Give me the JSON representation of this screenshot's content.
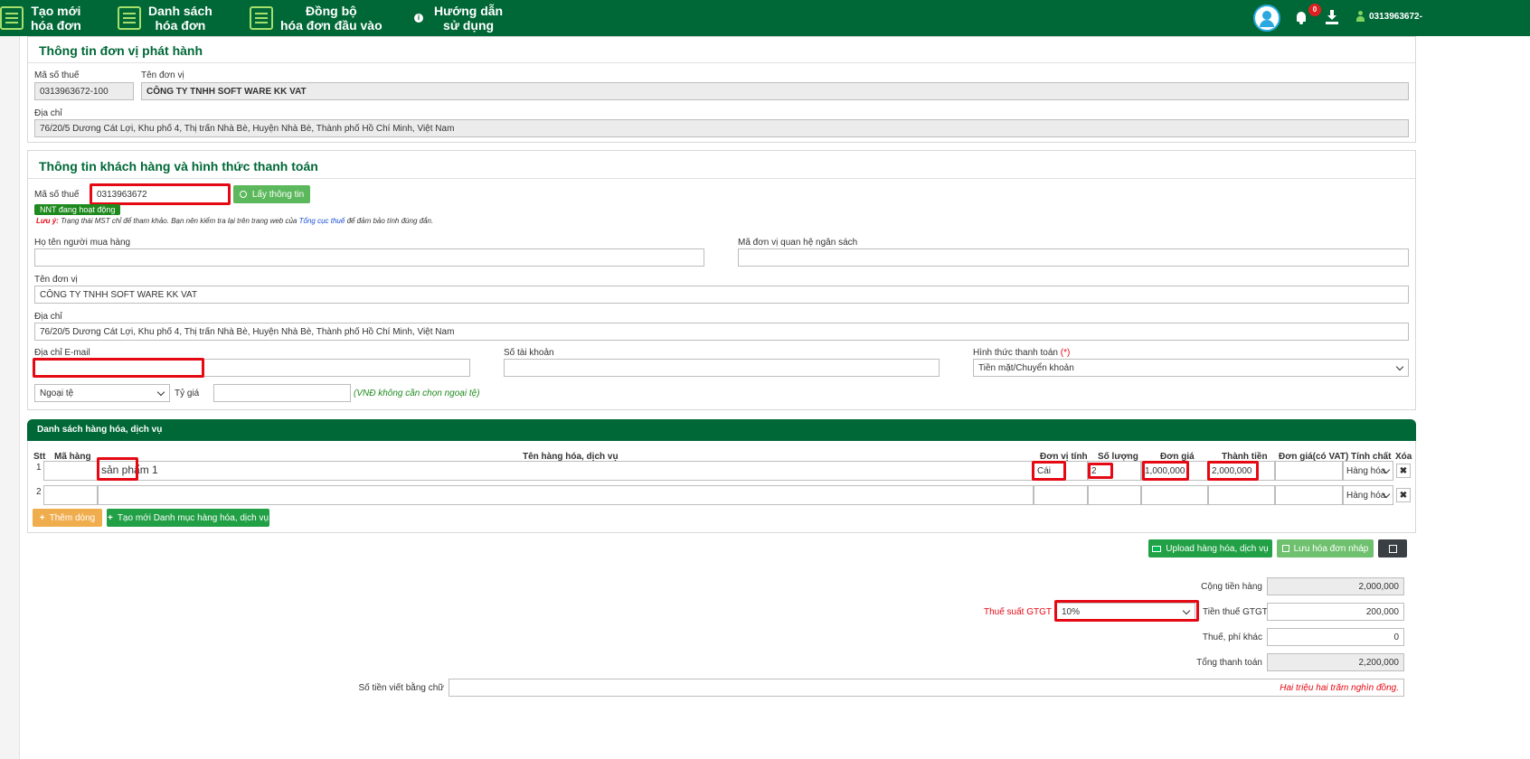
{
  "header": {
    "nav": [
      {
        "label1": "Tạo mới",
        "label2": "hóa đơn"
      },
      {
        "label1": "Danh sách",
        "label2": "hóa đơn"
      },
      {
        "label1": "Đồng bộ",
        "label2": "hóa đơn đầu vào"
      },
      {
        "label1": "Hướng dẫn",
        "label2": "sử dụng"
      }
    ],
    "notification_count": "0",
    "user": "0313963672-"
  },
  "issuer": {
    "title": "Thông tin đơn vị phát hành",
    "tax_code_label": "Mã số thuế",
    "tax_code": "0313963672-100",
    "unit_name_label": "Tên đơn vị",
    "unit_name": "CÔNG TY TNHH SOFT WARE KK VAT",
    "address_label": "Địa chỉ",
    "address": "76/20/5 Dương Cát Lợi, Khu phố 4, Thị trấn Nhà Bè, Huyện Nhà Bè, Thành phố Hồ Chí Minh, Việt Nam"
  },
  "customer": {
    "title": "Thông tin khách hàng và hình thức thanh toán",
    "tax_code_label": "Mã số thuế",
    "tax_code": "0313963672",
    "lookup_button": "Lấy thông tin",
    "status_badge": "NNT đang hoạt động",
    "note_prefix": "Lưu ý:",
    "note_text": "Trạng thái MST chỉ để tham khảo. Bạn nên kiểm tra lại trên trang web của",
    "note_link": "Tổng cục thuế",
    "note_suffix": "để đảm bảo tính đúng đắn.",
    "buyer_name_label": "Họ tên người mua hàng",
    "budget_unit_label": "Mã đơn vị quan hệ ngân sách",
    "unit_name_label": "Tên đơn vị",
    "unit_name": "CÔNG TY TNHH SOFT WARE KK VAT",
    "address_label": "Địa chỉ",
    "address": "76/20/5 Dương Cát Lợi, Khu phố 4, Thị trấn Nhà Bè, Huyện Nhà Bè, Thành phố Hồ Chí Minh, Việt Nam",
    "email_label": "Địa chỉ E-mail",
    "account_label": "Số tài khoản",
    "payment_label": "Hình thức thanh toán",
    "payment_required": "(*)",
    "payment_value": "Tiền mặt/Chuyển khoản",
    "currency_value": "Ngoại tệ",
    "rate_label": "Tỷ giá",
    "currency_note": "(VNĐ không cần chọn ngoại tệ)"
  },
  "goods": {
    "title": "Danh sách hàng hóa, dịch vụ",
    "columns": [
      "Stt",
      "Mã hàng",
      "Tên hàng hóa, dịch vụ",
      "Đơn vị tính",
      "Số lượng",
      "Đơn giá",
      "Thành tiền",
      "Đơn giá(có VAT)",
      "Tính chất",
      "Xóa"
    ],
    "rows": [
      {
        "stt": "1",
        "code": "",
        "name": "sản phẩm 1",
        "unit": "Cái",
        "qty": "2",
        "price": "1,000,000",
        "amount": "2,000,000",
        "price_vat": "",
        "nature": "Hàng hóa",
        "del": "✖"
      },
      {
        "stt": "2",
        "code": "",
        "name": "",
        "unit": "",
        "qty": "",
        "price": "",
        "amount": "",
        "price_vat": "",
        "nature": "Hàng hóa",
        "del": "✖"
      }
    ],
    "add_row_button": "Thêm dòng",
    "new_catalog_button": "Tạo mới Danh mục hàng hóa, dịch vụ",
    "upload_button": "Upload hàng hóa, dịch vụ",
    "save_draft_button": "Lưu hóa đơn nháp"
  },
  "totals": {
    "subtotal_label": "Cộng tiền hàng",
    "subtotal": "2,000,000",
    "vat_rate_label": "Thuế suất GTGT",
    "vat_rate": "10%",
    "vat_amount_label": "Tiền thuế GTGT",
    "vat_amount": "200,000",
    "other_fee_label": "Thuế, phí khác",
    "other_fee": "0",
    "grand_total_label": "Tổng thanh toán",
    "grand_total": "2,200,000",
    "in_words_label": "Số tiền viết bằng chữ",
    "in_words": "Hai triệu hai trăm nghìn đồng."
  },
  "colors": {
    "brand": "#006837",
    "highlight": "#e50914",
    "accent_green": "#5cb85c"
  }
}
